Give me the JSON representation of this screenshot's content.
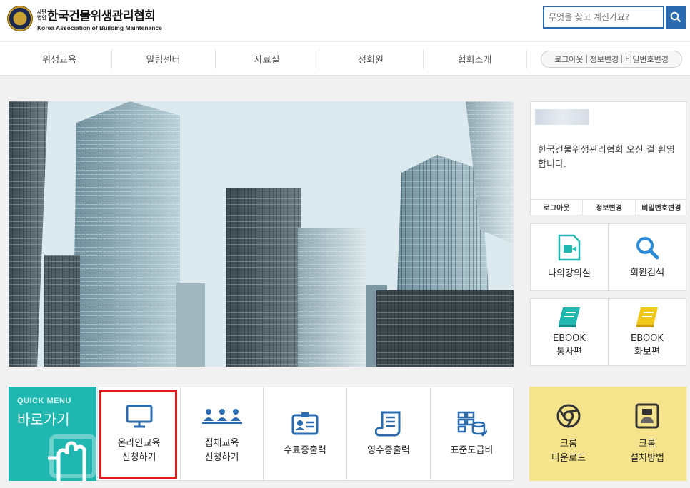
{
  "header": {
    "logo_small": "사단\n법인",
    "logo_ko": "한국건물위생관리협회",
    "logo_en": "Korea Association of Building Maintenance",
    "search_placeholder": "무엇을 찾고 계신가요?"
  },
  "nav": {
    "items": [
      "위생교육",
      "알림센터",
      "자료실",
      "정회원",
      "협회소개"
    ],
    "user_links": [
      "로그아웃",
      "정보변경",
      "비밀번호변경"
    ]
  },
  "login_box": {
    "welcome": "한국건물위생관리협회 오신 걸 환영합니다.",
    "links": [
      "로그아웃",
      "정보변경",
      "비밀번호변경"
    ]
  },
  "side_tiles": {
    "classroom": "나의강의실",
    "member_search": "회원검색",
    "ebook1": [
      "EBOOK",
      "통사편"
    ],
    "ebook2": [
      "EBOOK",
      "화보편"
    ]
  },
  "quick_menu": {
    "en": "QUICK MENU",
    "ko": "바로가기",
    "items": [
      [
        "온라인교육",
        "신청하기"
      ],
      [
        "집체교육",
        "신청하기"
      ],
      [
        "수료증출력"
      ],
      [
        "영수증출력"
      ],
      [
        "표준도급비"
      ]
    ]
  },
  "chrome": {
    "download": [
      "크롬",
      "다운로드"
    ],
    "install": [
      "크롬",
      "설치방법"
    ]
  },
  "colors": {
    "accent_blue": "#2a6bb0",
    "teal": "#1fb7b0",
    "chrome_yellow": "#f5e48c",
    "highlight_red": "#e51a1a"
  }
}
